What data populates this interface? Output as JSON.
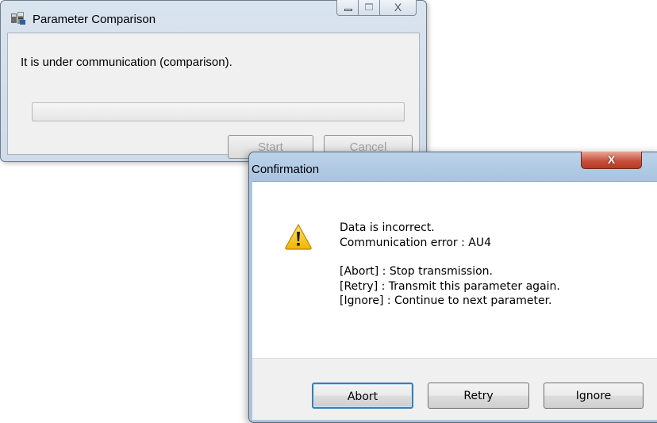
{
  "background_window": {
    "title": "Parameter Comparison",
    "app_icon": "parameter-app-icon",
    "caption_buttons": {
      "minimize": "minimize-icon",
      "maximize": "maximize-icon",
      "close": "X"
    },
    "status_text": "It is under communication (comparison).",
    "progress_fraction": 0,
    "buttons": {
      "start": "Start",
      "cancel": "Cancel"
    }
  },
  "dialog": {
    "title": "Confirmation",
    "close_label": "X",
    "icon": "warning-icon",
    "message": {
      "line1": "Data is incorrect.",
      "line2": "Communication error : AU4",
      "line3": "[Abort] : Stop transmission.",
      "line4": "[Retry] : Transmit this parameter again.",
      "line5": "[Ignore] : Continue to next parameter."
    },
    "buttons": {
      "abort": "Abort",
      "retry": "Retry",
      "ignore": "Ignore"
    }
  },
  "colors": {
    "warning_yellow": "#f5c400",
    "close_red": "#c7523d",
    "focus_blue": "#3c7fb1"
  }
}
